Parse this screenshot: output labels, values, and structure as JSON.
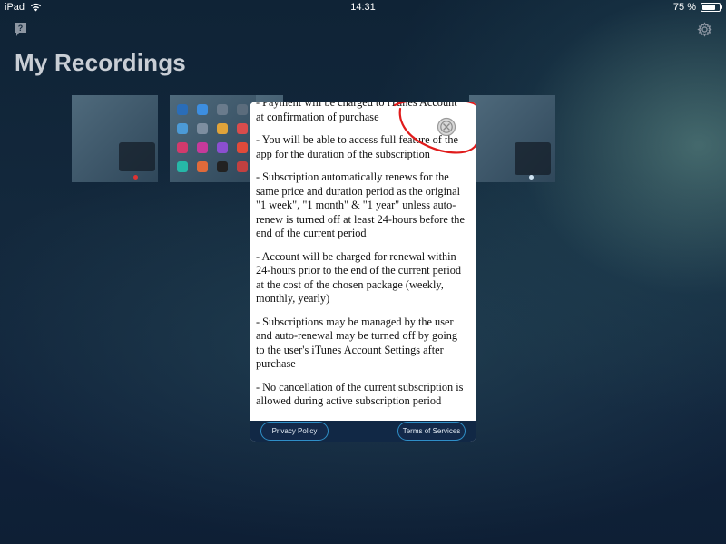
{
  "status_bar": {
    "device": "iPad",
    "time": "14:31",
    "battery_text": "75 %",
    "battery_level_percent": 75
  },
  "header": {
    "title": "My Recordings"
  },
  "icons": {
    "help": "help-icon",
    "settings": "gear-icon",
    "close": "close-icon",
    "wifi": "wifi-icon",
    "battery": "battery-icon"
  },
  "modal": {
    "paragraphs": [
      "- Payment will be charged to iTunes Account at confirmation of purchase",
      "- You will be able to access full feature of the app for the duration of the subscription",
      "- Subscription automatically renews for the same price and duration period as the original \"1 week\", \"1 month\" & \"1 year\" unless auto-renew is turned off at least 24-hours before the end of the current period",
      "- Account will be charged for renewal within 24-hours prior to the end of the current period at the cost of the chosen package (weekly, monthly, yearly)",
      "- Subscriptions may be managed by the user and auto-renewal may be turned off by going to the user's iTunes Account Settings after purchase",
      "- No cancellation of the current subscription is allowed during active subscription period"
    ],
    "privacy_label": "Privacy Policy",
    "terms_label": "Terms of Services"
  },
  "colors": {
    "annotation": "#e01b1b",
    "footer_bg": "#112845",
    "footer_border": "#2f8fc7"
  }
}
